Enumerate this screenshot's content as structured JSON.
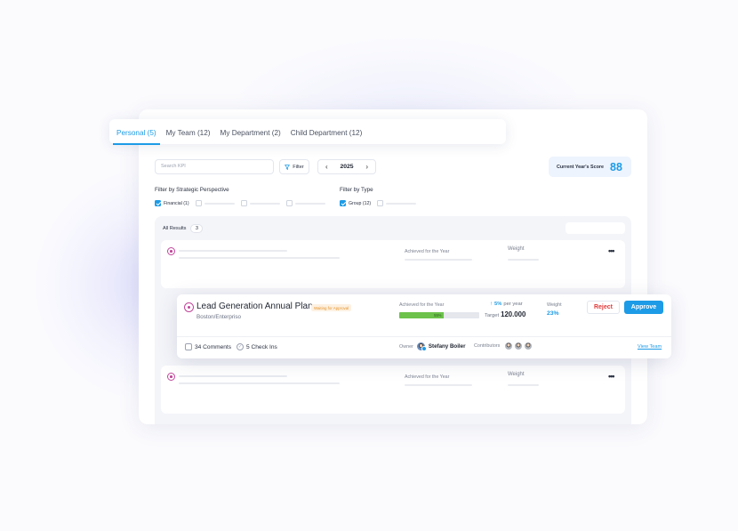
{
  "tabs": [
    {
      "label": "Personal (5)",
      "active": true
    },
    {
      "label": "My Team (12)",
      "active": false
    },
    {
      "label": "My Department (2)",
      "active": false
    },
    {
      "label": "Child Department (12)",
      "active": false
    }
  ],
  "toolbar": {
    "search_placeholder": "Search KPI",
    "filter_label": "Filter",
    "year": "2025",
    "prev_icon": "‹",
    "next_icon": "›"
  },
  "score": {
    "label": "Current Year's Score",
    "value": "88"
  },
  "filters": {
    "perspective_title": "Filter by Strategic Perspective",
    "perspective_checked": "Financial (1)",
    "type_title": "Filter by Type",
    "type_checked": "Group (12)"
  },
  "results": {
    "label": "All Results",
    "count": "3"
  },
  "row_placeholder": {
    "achieved_label": "Achieved for the Year",
    "weight_label": "Weight"
  },
  "featured": {
    "title": "Lead Generation Annual Plan",
    "status": "Waiting for Approval",
    "subtitle": "Boston/Enterpriso",
    "achieved_label": "Achieved for the Year",
    "progress_pct": 55,
    "progress_text": "55%",
    "growth_pct": "5%",
    "growth_text": "per year",
    "target_label": "Target",
    "target_value": "120.000",
    "weight_label": "Weight",
    "weight_value": "23%",
    "reject_label": "Reject",
    "approve_label": "Approve",
    "comments": "34 Comments",
    "checkins": "5 Check Ins",
    "owner_label": "Owner",
    "owner_name": "Stefany Boiler",
    "contributors_label": "Contributors",
    "view_team_label": "View Team"
  },
  "colors": {
    "accent": "#1d9be6",
    "reject": "#e03b3b",
    "progress": "#6cc24a",
    "status_badge": "#e6922b"
  }
}
